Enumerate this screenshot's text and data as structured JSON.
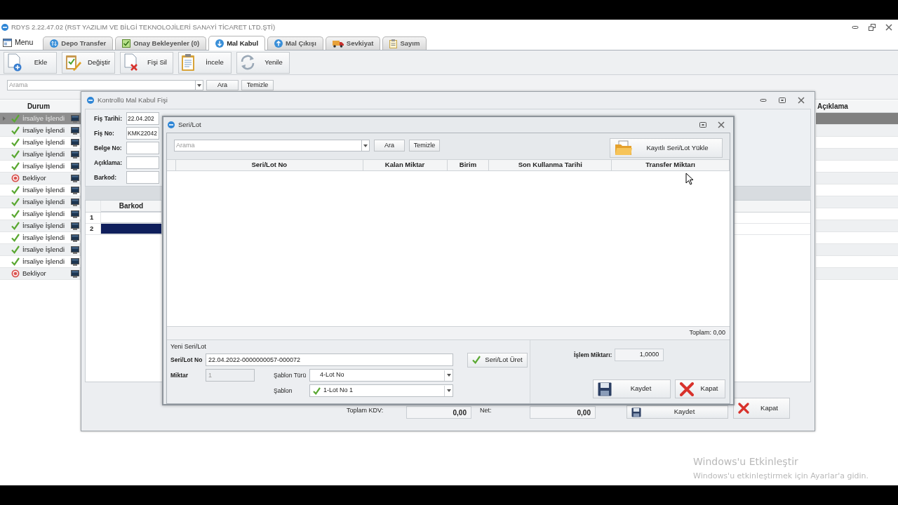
{
  "app": {
    "title": "RDYS 2.22.47.02  (RST YAZILIM VE BİLGİ TEKNOLOJİLERİ SANAYİ TİCARET LTD.ŞTİ)"
  },
  "menu": {
    "label": "Menu"
  },
  "tabs": [
    {
      "label": "Depo Transfer",
      "kind": "transfer",
      "selected": false
    },
    {
      "label": "Onay Bekleyenler (0)",
      "kind": "approval",
      "selected": false
    },
    {
      "label": "Mal Kabul",
      "kind": "inbound",
      "selected": true
    },
    {
      "label": "Mal Çıkışı",
      "kind": "outbound",
      "selected": false
    },
    {
      "label": "Sevkiyat",
      "kind": "shipment",
      "selected": false
    },
    {
      "label": "Sayım",
      "kind": "count",
      "selected": false
    }
  ],
  "toolbar": [
    {
      "label": "Ekle",
      "kind": "add"
    },
    {
      "label": "Değiştir",
      "kind": "edit"
    },
    {
      "label": "Fişi Sil",
      "kind": "delete"
    },
    {
      "label": "İncele",
      "kind": "view"
    },
    {
      "label": "Yenile",
      "kind": "refresh"
    }
  ],
  "search": {
    "placeholder": "Arama",
    "buttons": [
      "Ara",
      "Temizle"
    ]
  },
  "list": {
    "columns": [
      "Durum"
    ],
    "rows": [
      {
        "status": "İrsaliye İşlendi",
        "kind": "done",
        "selected": true
      },
      {
        "status": "İrsaliye İşlendi",
        "kind": "done",
        "selected": false
      },
      {
        "status": "İrsaliye İşlendi",
        "kind": "done",
        "selected": false
      },
      {
        "status": "İrsaliye İşlendi",
        "kind": "done",
        "selected": false
      },
      {
        "status": "İrsaliye İşlendi",
        "kind": "done",
        "selected": false
      },
      {
        "status": "Bekliyor",
        "kind": "waiting",
        "selected": false
      },
      {
        "status": "İrsaliye İşlendi",
        "kind": "done",
        "selected": false
      },
      {
        "status": "İrsaliye İşlendi",
        "kind": "done",
        "selected": false
      },
      {
        "status": "İrsaliye İşlendi",
        "kind": "done",
        "selected": false
      },
      {
        "status": "İrsaliye İşlendi",
        "kind": "done",
        "selected": false
      },
      {
        "status": "İrsaliye İşlendi",
        "kind": "done",
        "selected": false
      },
      {
        "status": "İrsaliye İşlendi",
        "kind": "done",
        "selected": false
      },
      {
        "status": "İrsaliye İşlendi",
        "kind": "done",
        "selected": false
      },
      {
        "status": "Bekliyor",
        "kind": "waiting",
        "selected": false
      }
    ]
  },
  "notes_column": {
    "header": "Açıklama"
  },
  "receipt_window": {
    "title": "Kontrollü Mal Kabul Fişi",
    "fields": [
      {
        "label": "Fiş Tarihi:",
        "value": "22.04.202"
      },
      {
        "label": "Fiş No:",
        "value": "KMK22042"
      },
      {
        "label": "Belge No:"
      },
      {
        "label": "Açıklama:"
      },
      {
        "label": "Barkod:"
      }
    ],
    "grid": {
      "columns": [
        "Barkod"
      ],
      "rows": [
        {
          "number": "1",
          "selected": false
        },
        {
          "number": "2",
          "selected": true
        }
      ]
    },
    "totals": [
      {
        "label": "Toplam KDV:",
        "value": "0,00"
      },
      {
        "label": "Net:",
        "value": "0,00"
      }
    ],
    "buttons": [
      {
        "label": "Kaydet",
        "kind": "save"
      },
      {
        "label": "Kapat",
        "kind": "close"
      }
    ]
  },
  "dialog": {
    "title": "Seri/Lot",
    "search": {
      "placeholder": "Arama",
      "buttons": [
        "Ara",
        "Temizle"
      ]
    },
    "load_button": "Kayıtlı Seri/Lot Yükle",
    "columns": [
      "Seri/Lot No",
      "Kalan Miktar",
      "Birim",
      "Son Kullanma Tarihi",
      "Transfer Miktarı"
    ],
    "footer": "Toplam: 0,00",
    "group_label": "Yeni Seri/Lot",
    "serial": {
      "label": "Seri/Lot No",
      "value": "22.04.2022-0000000057-000072"
    },
    "generate_button": "Seri/Lot Üret",
    "quantity": {
      "label": "Miktar",
      "value": "1",
      "disabled": true
    },
    "template_type": {
      "label": "Şablon Türü",
      "value": "4-Lot No"
    },
    "template": {
      "label": "Şablon",
      "value": "1-Lot No 1"
    },
    "amount": {
      "label": "İşlem Miktarı:",
      "value": "1,0000"
    },
    "buttons": [
      {
        "label": "Kaydet",
        "kind": "save"
      },
      {
        "label": "Kapat",
        "kind": "close"
      }
    ]
  },
  "watermark": {
    "title": "Windows'u Etkinleştir",
    "text": "Windows'u etkinleştirmek için Ayarlar'a gidin."
  }
}
